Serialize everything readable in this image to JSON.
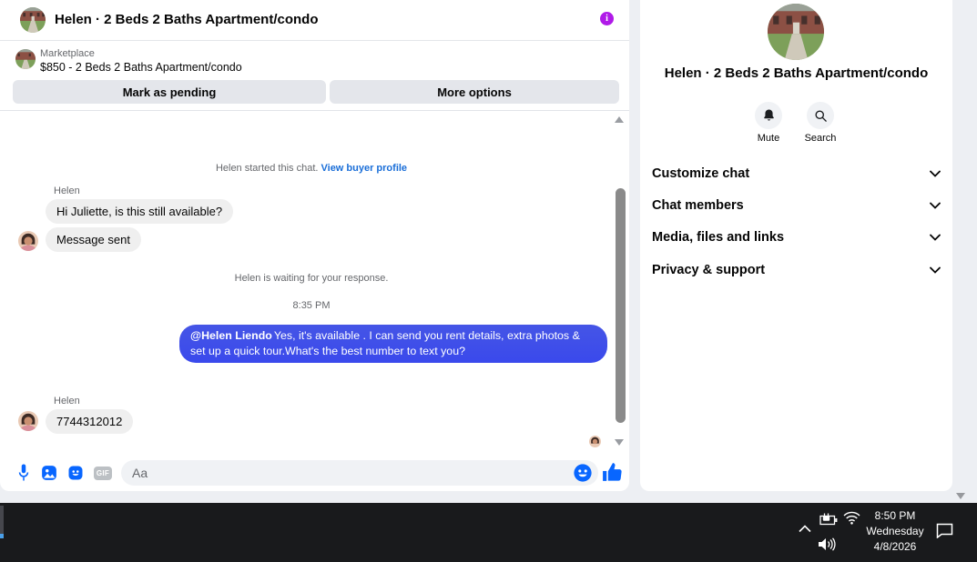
{
  "colors": {
    "accent_blue": "#0866ff",
    "outgoing_bubble_blue": "#3e4eea",
    "link_blue": "#1a6ed8",
    "info_purple": "#b01ae8",
    "incoming_bubble_gray": "#efefef",
    "taskbar_black": "#191a1c"
  },
  "header": {
    "title": "Helen · 2 Beds 2 Baths Apartment/condo",
    "info_icon_glyph": "i"
  },
  "banner": {
    "source": "Marketplace",
    "listing": "$850 - 2 Beds 2 Baths Apartment/condo",
    "mark_pending_label": "Mark as pending",
    "more_options_label": "More options"
  },
  "chat": {
    "start_notice": "Helen started this chat. ",
    "start_link": "View buyer profile",
    "sender_name": "Helen",
    "incoming_1": "Hi Juliette, is this still available?",
    "incoming_2": "Message sent",
    "waiting_text": "Helen is waiting for your response.",
    "timestamp": "8:35 PM",
    "outgoing_mention": "@Helen Liendo",
    "outgoing_text": "Yes, it's available .  I can send you rent details, extra photos & set up a quick tour.What's the best number to text you?",
    "sender_name_2": "Helen",
    "incoming_3": "7744312012"
  },
  "composer": {
    "placeholder": "Aa",
    "gif_label": "GIF"
  },
  "sidebar": {
    "title": "Helen · 2 Beds 2 Baths Apartment/condo",
    "mute_label": "Mute",
    "search_label": "Search",
    "sections": [
      {
        "label": "Customize chat"
      },
      {
        "label": "Chat members"
      },
      {
        "label": "Media, files and links"
      },
      {
        "label": "Privacy & support"
      }
    ]
  },
  "taskbar": {
    "time": "8:50 PM",
    "day": "Wednesday",
    "date": "4/8/2026"
  }
}
